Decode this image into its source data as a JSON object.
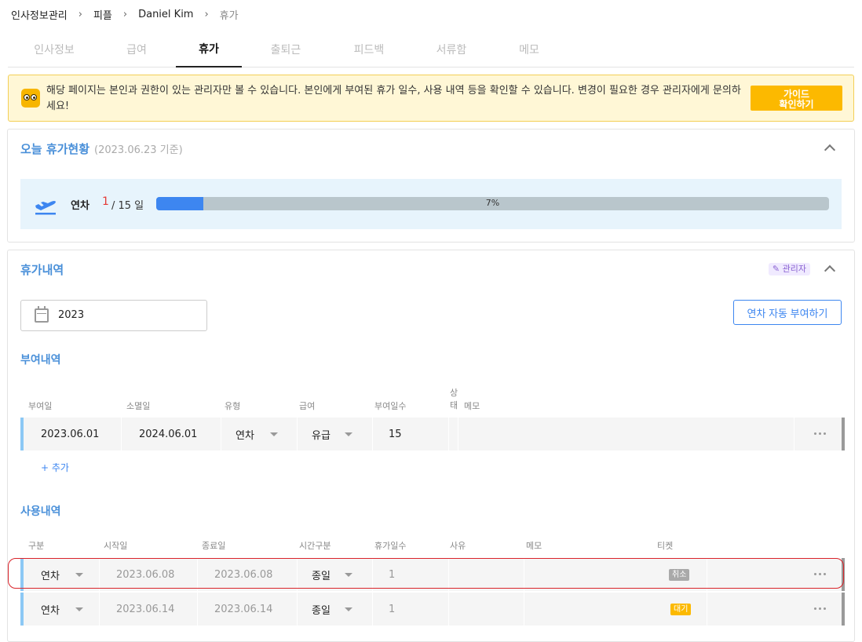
{
  "breadcrumb": {
    "items": [
      "인사정보관리",
      "피플",
      "Daniel Kim",
      "휴가"
    ]
  },
  "tabs": [
    "인사정보",
    "급여",
    "휴가",
    "출퇴근",
    "피드백",
    "서류함",
    "메모"
  ],
  "active_tab": "휴가",
  "notice": {
    "message": "해당 페이지는 본인과 권한이 있는 관리자만 볼 수 있습니다. 본인에게 부여된 휴가 일수, 사용 내역 등을 확인할 수 있습니다. 변경이 필요한 경우 관리자에게 문의하세요!",
    "guide_line1": "가이드",
    "guide_line2": "확인하기"
  },
  "today": {
    "title": "오늘 휴가현황",
    "date_note": "(2023.06.23 기준)",
    "leave_label": "연차",
    "used": "1",
    "total": "/ 15 일",
    "progress": 0.07,
    "progress_text": "7%"
  },
  "history": {
    "title": "휴가내역",
    "admin_badge": "관리자",
    "year": "2023",
    "auto_button": "연차 자동 부여하기"
  },
  "grant": {
    "title": "부여내역",
    "headers": [
      "부여일",
      "소멸일",
      "유형",
      "급여",
      "부여일수",
      "상태",
      "메모"
    ],
    "rows": [
      {
        "grant_date": "2023.06.01",
        "expire_date": "2024.06.01",
        "type": "연차",
        "pay": "유급",
        "days": "15",
        "status": "",
        "memo": ""
      }
    ],
    "add_label": "+ 추가"
  },
  "usage": {
    "title": "사용내역",
    "headers": [
      "구분",
      "시작일",
      "종료일",
      "시간구분",
      "휴가일수",
      "사유",
      "메모",
      "티켓"
    ],
    "rows": [
      {
        "type": "연차",
        "start": "2023.06.08",
        "end": "2023.06.08",
        "time": "종일",
        "days": "1",
        "reason": "",
        "memo": "",
        "ticket": "취소"
      },
      {
        "type": "연차",
        "start": "2023.06.14",
        "end": "2023.06.14",
        "time": "종일",
        "days": "1",
        "reason": "",
        "memo": "",
        "ticket": "대기"
      }
    ]
  },
  "colors": {
    "accent": "#4a90d9",
    "primary": "#3d86f0",
    "notice_bg": "#fff7d6",
    "guide_button": "#fcb900",
    "danger": "#d9232a"
  }
}
